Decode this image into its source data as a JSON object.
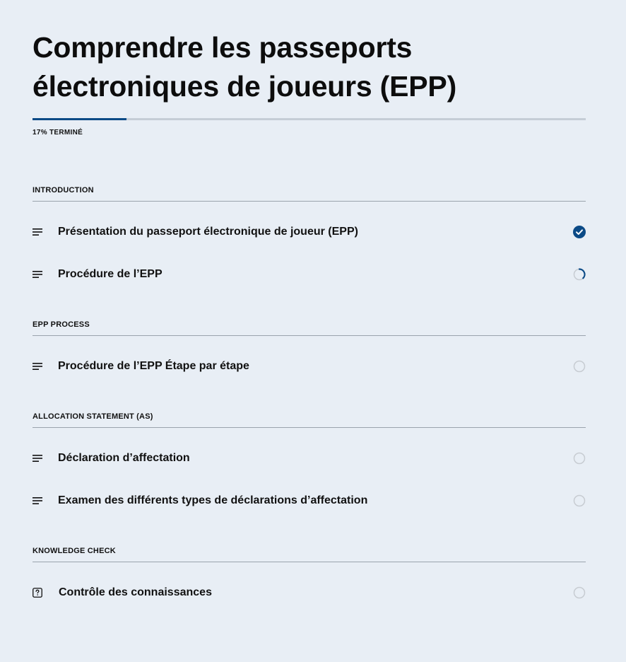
{
  "course": {
    "title": "Comprendre les passeports électroniques de joueurs (EPP)",
    "progress_percent": 17,
    "progress_label": "17% TERMINÉ"
  },
  "colors": {
    "accent": "#0b4a86",
    "track": "#c5cdd6",
    "background": "#e8eef5",
    "status_pending": "#c7ccd2"
  },
  "sections": [
    {
      "header": "INTRODUCTION",
      "lessons": [
        {
          "title": "Présentation du passeport électronique de joueur (EPP)",
          "icon": "lines-icon",
          "status": "completed"
        },
        {
          "title": "Procédure de l’EPP",
          "icon": "lines-icon",
          "status": "in-progress"
        }
      ]
    },
    {
      "header": "EPP PROCESS",
      "lessons": [
        {
          "title": "Procédure de l’EPP Étape par étape",
          "icon": "lines-icon",
          "status": "not-started"
        }
      ]
    },
    {
      "header": "ALLOCATION STATEMENT (AS)",
      "lessons": [
        {
          "title": "Déclaration d’affectation",
          "icon": "lines-icon",
          "status": "not-started"
        },
        {
          "title": "Examen des différents types de déclarations d’affectation",
          "icon": "lines-icon",
          "status": "not-started"
        }
      ]
    },
    {
      "header": "KNOWLEDGE CHECK",
      "lessons": [
        {
          "title": "Contrôle des connaissances",
          "icon": "quiz-icon",
          "status": "not-started"
        }
      ]
    }
  ]
}
